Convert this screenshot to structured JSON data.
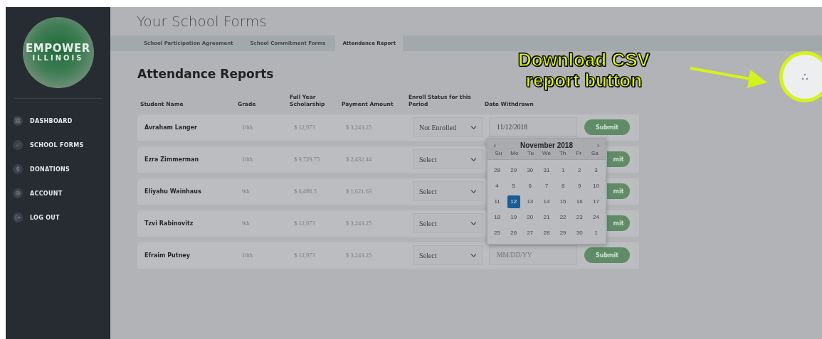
{
  "sidebar": {
    "logo": {
      "line1": "EMPOWER",
      "line2": "ILLINOIS"
    },
    "items": [
      {
        "label": "DASHBOARD"
      },
      {
        "label": "SCHOOL FORMS"
      },
      {
        "label": "DONATIONS"
      },
      {
        "label": "ACCOUNT"
      },
      {
        "label": "LOG OUT"
      }
    ]
  },
  "page_title": "Your School Forms",
  "tabs": [
    {
      "label": "School Participation Agreement",
      "selected": false
    },
    {
      "label": "School Commitment Forms",
      "selected": false
    },
    {
      "label": "Attendance Report",
      "selected": true
    }
  ],
  "heading": "Attendance Reports",
  "table": {
    "columns": [
      "Student Name",
      "Grade",
      "Full Year Scholarship",
      "Payment Amount",
      "Enroll Status for this Period",
      "Date Withdrawn"
    ],
    "rows": [
      {
        "name": "Avraham Langer",
        "grade": "10th",
        "scholarship": "$ 12,973",
        "payment": "$ 3,243.25",
        "status": "Not Enrolled",
        "date": {
          "value": "11/12/2018"
        },
        "submit": "Submit"
      },
      {
        "name": "Ezra Zimmerman",
        "grade": "10th",
        "scholarship": "$ 9,729.75",
        "payment": "$ 2,432.44",
        "status": "Select",
        "submit": "mit"
      },
      {
        "name": "Eliyahu Wainhaus",
        "grade": "9th",
        "scholarship": "$ 6,486.5",
        "payment": "$ 1,621.63",
        "status": "Select",
        "submit": "mit"
      },
      {
        "name": "Tzvi Rabinovitz",
        "grade": "9th",
        "scholarship": "$ 12,973",
        "payment": "$ 3,243.25",
        "status": "Select",
        "submit": "mit"
      },
      {
        "name": "Efraim Putney",
        "grade": "10th",
        "scholarship": "$ 12,973",
        "payment": "$ 3,243.25",
        "status": "Select",
        "date": {
          "placeholder": "MM/DD/YY"
        },
        "submit": "Submit"
      }
    ]
  },
  "datepicker": {
    "prev": "‹",
    "month": "November 2018",
    "next": "›",
    "weekdays": [
      "Su",
      "Mo",
      "Tu",
      "We",
      "Th",
      "Fr",
      "Sa"
    ],
    "weeks": [
      [
        {
          "label": "28",
          "selected": false
        },
        {
          "label": "29",
          "selected": false
        },
        {
          "label": "30",
          "selected": false
        },
        {
          "label": "31",
          "selected": false
        },
        {
          "label": "1",
          "selected": false
        },
        {
          "label": "2",
          "selected": false
        },
        {
          "label": "3",
          "selected": false
        }
      ],
      [
        {
          "label": "4",
          "selected": false
        },
        {
          "label": "5",
          "selected": false
        },
        {
          "label": "6",
          "selected": false
        },
        {
          "label": "7",
          "selected": false
        },
        {
          "label": "8",
          "selected": false
        },
        {
          "label": "9",
          "selected": false
        },
        {
          "label": "10",
          "selected": false
        }
      ],
      [
        {
          "label": "11",
          "selected": false
        },
        {
          "label": "12",
          "selected": true
        },
        {
          "label": "13",
          "selected": false
        },
        {
          "label": "14",
          "selected": false
        },
        {
          "label": "15",
          "selected": false
        },
        {
          "label": "16",
          "selected": false
        },
        {
          "label": "17",
          "selected": false
        }
      ],
      [
        {
          "label": "18",
          "selected": false
        },
        {
          "label": "19",
          "selected": false
        },
        {
          "label": "20",
          "selected": false
        },
        {
          "label": "21",
          "selected": false
        },
        {
          "label": "22",
          "selected": false
        },
        {
          "label": "23",
          "selected": false
        },
        {
          "label": "24",
          "selected": false
        }
      ],
      [
        {
          "label": "25",
          "selected": false
        },
        {
          "label": "26",
          "selected": false
        },
        {
          "label": "27",
          "selected": false
        },
        {
          "label": "28",
          "selected": false
        },
        {
          "label": "29",
          "selected": false
        },
        {
          "label": "30",
          "selected": false
        },
        {
          "label": "1",
          "selected": false
        }
      ]
    ]
  },
  "annotation": {
    "lines": [
      "Download CSV",
      "report button"
    ]
  }
}
